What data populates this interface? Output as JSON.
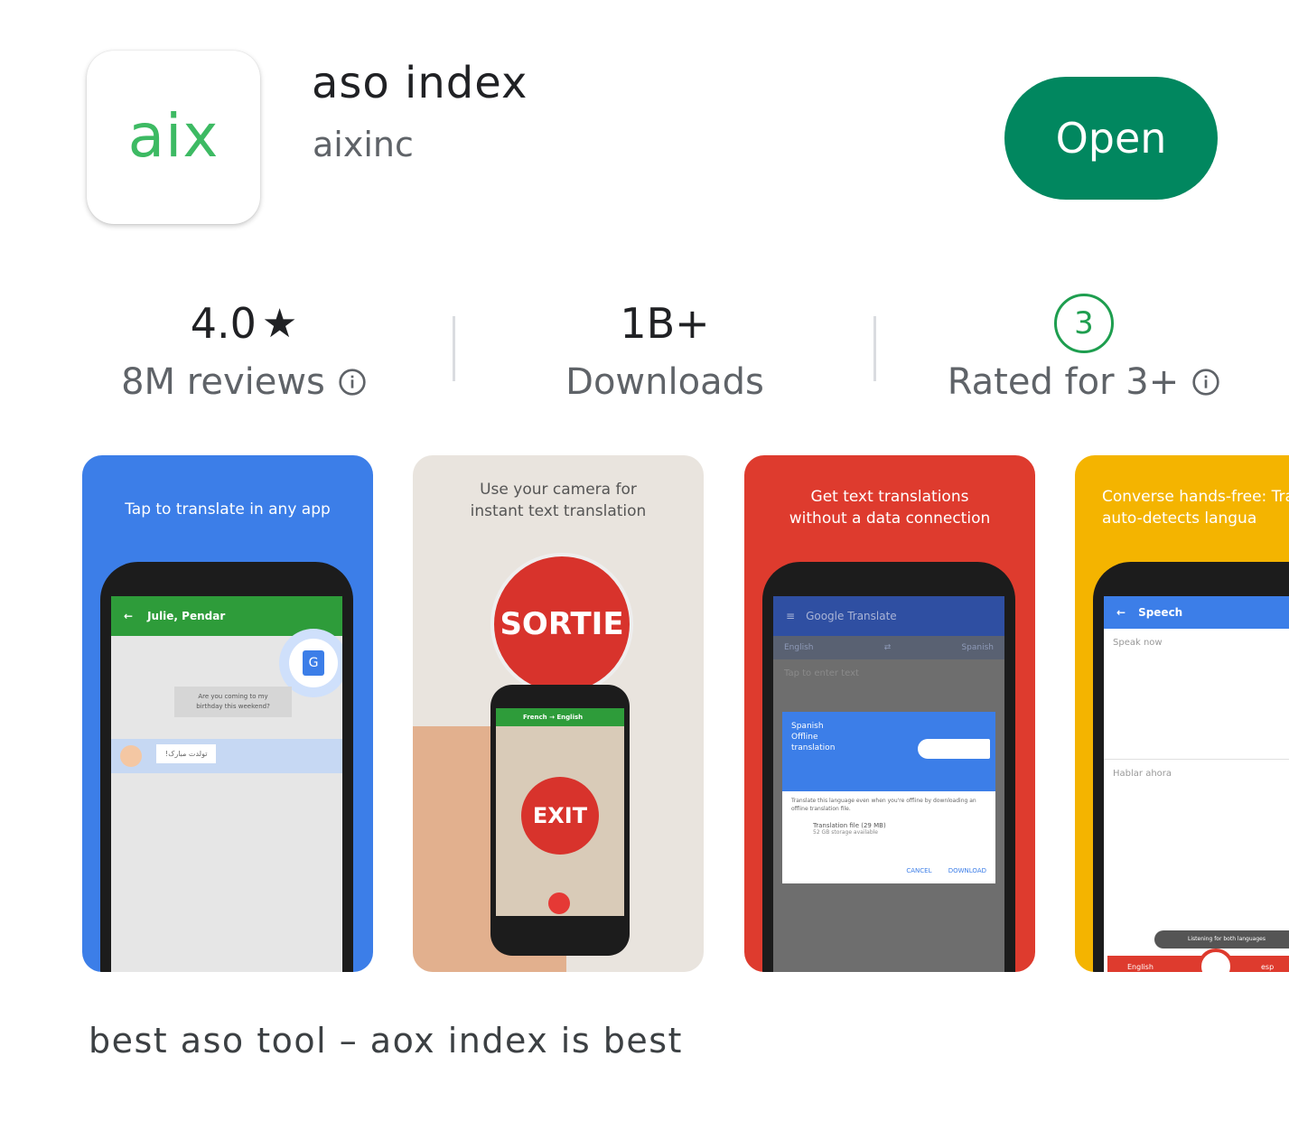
{
  "app": {
    "icon_text": "aix",
    "title": "aso index",
    "developer": "aixinc",
    "open_label": "Open"
  },
  "stats": {
    "rating_value": "4.0",
    "rating_star": "★",
    "reviews_label": "8M reviews",
    "downloads_value": "1B+",
    "downloads_label": "Downloads",
    "age_badge": "3",
    "age_label": "Rated for 3+"
  },
  "screenshots": [
    {
      "caption": "Tap to translate in any app",
      "bg": "#3c7ee8",
      "chat_header": "Julie, Pendar",
      "bubble_in": "Are you coming to my\nbirthday this weekend?",
      "bubble_out": "!تولدت مبارک"
    },
    {
      "caption": "Use your camera for\ninstant text translation",
      "bg": "#e9e4de",
      "sign_text": "SORTIE",
      "phone_header": "French → English",
      "phone_sign": "EXIT"
    },
    {
      "caption": "Get text translations\nwithout a data connection",
      "bg": "#de3b2e",
      "app_bar": "Google Translate",
      "lang_from": "English",
      "lang_to": "Spanish",
      "input_hint": "Tap to enter text",
      "dialog_title": "Spanish\nOffline\ntranslation",
      "dialog_body": "Translate this language even when you're offline by downloading an offline translation file.",
      "file_label": "Translation file (29 MB)",
      "storage_label": "52 GB storage available",
      "cancel": "CANCEL",
      "download": "DOWNLOAD"
    },
    {
      "caption": "Converse hands-free: Tra\nauto-detects langua",
      "bg": "#f4b400",
      "app_bar": "Speech",
      "speak_now": "Speak now",
      "hablar": "Hablar ahora",
      "listening": "Listening for both languages",
      "lang_left": "English",
      "lang_right": "esp"
    }
  ],
  "description": "best aso tool – aox index is best",
  "colors": {
    "accent": "#01875f",
    "icon_green": "#3dba63",
    "age_green": "#1e9e4f"
  }
}
